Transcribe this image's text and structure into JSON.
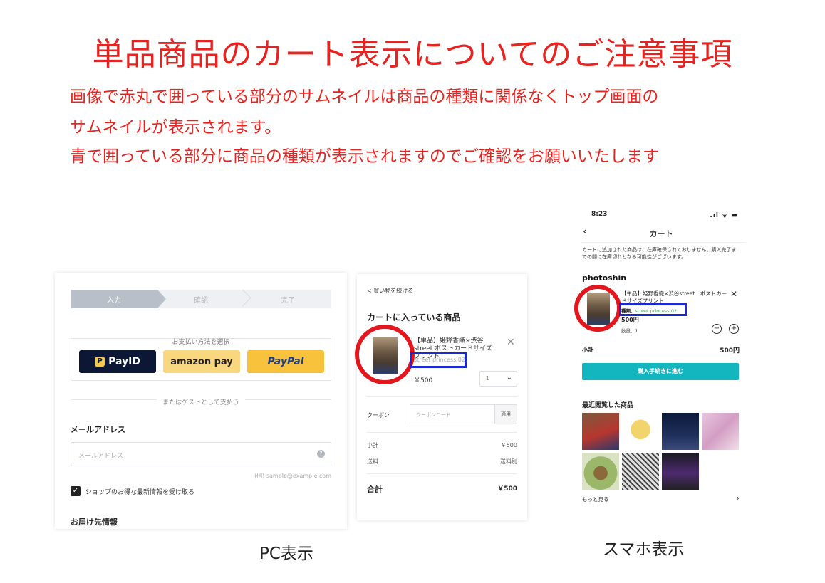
{
  "heading": "単品商品のカート表示についてのご注意事項",
  "notes": [
    "画像で赤丸で囲っている部分のサムネイルは商品の種類に関係なくトップ画面の",
    "サムネイルが表示されます。",
    "青で囲っている部分に商品の種類が表示されますのでご確認をお願いいたします"
  ],
  "pc_checkout": {
    "steps": [
      "入力",
      "確認",
      "完了"
    ],
    "payment_method_title": "お支払い方法を選択",
    "payment_buttons": [
      "PayID",
      "amazon pay",
      "PayPal"
    ],
    "guest_divider": "またはゲストとして支払う",
    "email_label": "メールアドレス",
    "email_placeholder": "メールアドレス",
    "email_example": "(例) sample@example.com",
    "newsletter_label": "ショップのお得な最新情報を受け取る",
    "shipping_label": "お届け先情報"
  },
  "pc_cart": {
    "back_link": "< 買い物を続ける",
    "title": "カートに入っている商品",
    "item_name": "【単品】姫野香織×渋谷street ポストカードサイズプリント",
    "item_variant": "street princess 02",
    "item_price": "￥500",
    "quantity": "1",
    "coupon_label": "クーポン",
    "coupon_placeholder": "クーポンコード",
    "coupon_apply": "適用",
    "subtotal_label": "小計",
    "subtotal_value": "￥500",
    "shipping_label": "送料",
    "shipping_value": "送料別",
    "total_label": "合計",
    "total_value": "￥500"
  },
  "captions": {
    "pc": "PC表示",
    "sp": "スマホ表示"
  },
  "sp_cart": {
    "time": "8:23",
    "status_icons": ".ıl ᯤ ▬",
    "title": "カート",
    "notice": "カートに追加された商品は、在庫確保されておりません。購入完了までの間に在庫切れとなる可能性がございます。",
    "shop_name": "photoshin",
    "item_name": "【単品】姫野香織×渋谷street　ポストカードサイズプリント",
    "variant_label": "種類：",
    "variant_value": "street princess 02",
    "price": "500円",
    "quantity_label": "数量：1",
    "subtotal_label": "小計",
    "subtotal_value": "500円",
    "checkout_button": "購入手続きに進む",
    "recent_title": "最近閲覧した商品",
    "more_link": "もっと見る"
  },
  "colors": {
    "accent_red": "#e8231f",
    "highlight_blue": "#1a29d6",
    "teal": "#13b5bf"
  }
}
